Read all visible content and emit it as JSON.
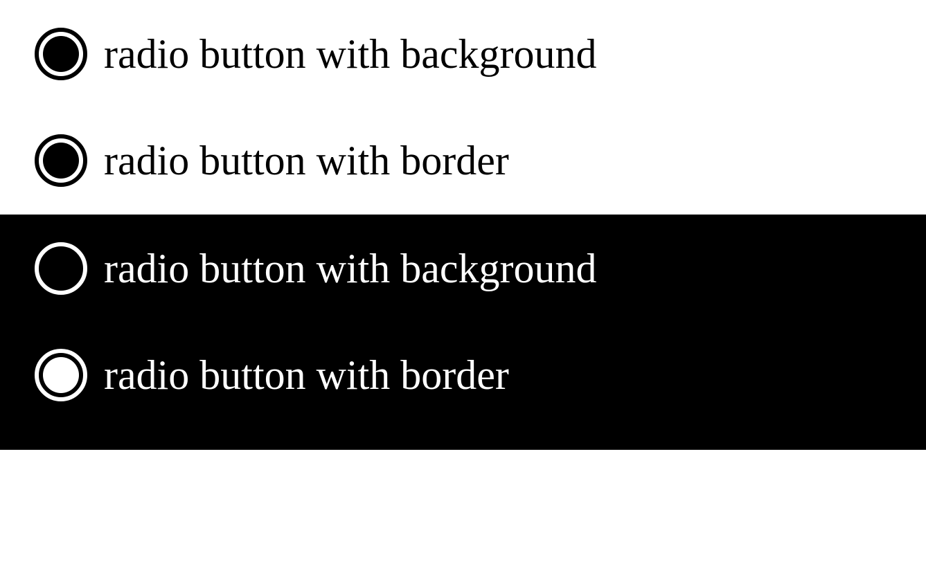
{
  "light": {
    "row1": {
      "label": "radio button with background"
    },
    "row2": {
      "label": "radio button with border"
    }
  },
  "dark": {
    "row1": {
      "label": "radio button with background"
    },
    "row2": {
      "label": "radio button with border"
    }
  }
}
